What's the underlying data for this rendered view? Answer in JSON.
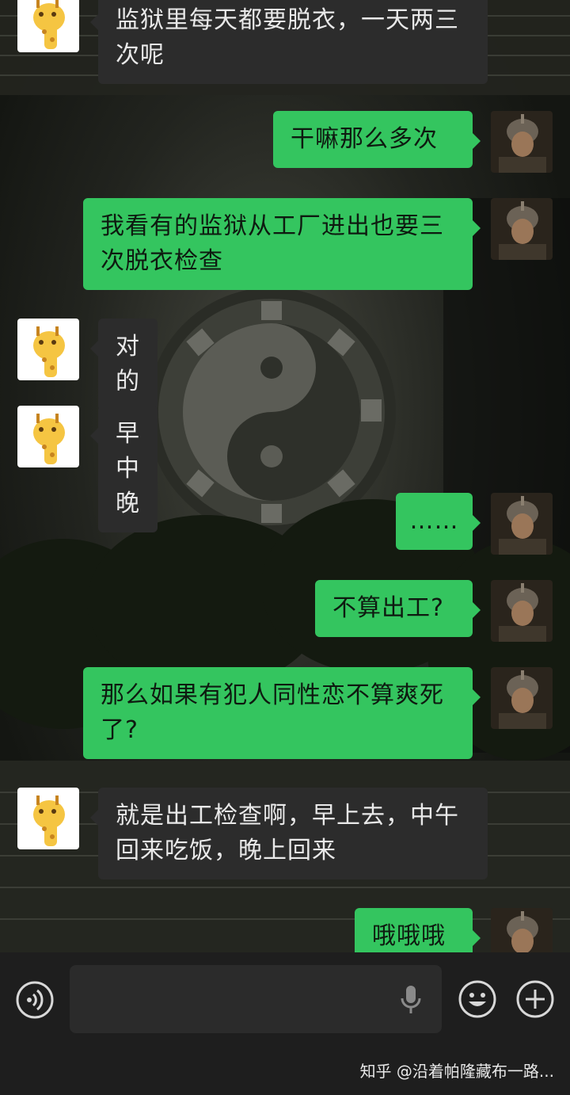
{
  "messages": [
    {
      "side": "in",
      "text": "监狱里每天都要脱衣，一天两三次呢"
    },
    {
      "side": "out",
      "text": "干嘛那么多次"
    },
    {
      "side": "out",
      "text": "我看有的监狱从工厂进出也要三次脱衣检查"
    },
    {
      "side": "in",
      "text": "对的"
    },
    {
      "side": "in",
      "text": "早中晚"
    },
    {
      "side": "out",
      "text": "……"
    },
    {
      "side": "out",
      "text": "不算出工?"
    },
    {
      "side": "out",
      "text": "那么如果有犯人同性恋不算爽死了?"
    },
    {
      "side": "in",
      "text": "就是出工检查啊，早上去，中午回来吃饭，晚上回来"
    },
    {
      "side": "out",
      "text": "哦哦哦"
    }
  ],
  "input_bar": {
    "voice_icon": "voice-toggle-icon",
    "mic_icon": "microphone-icon",
    "emoji_icon": "emoji-icon",
    "plus_icon": "plus-icon"
  },
  "footer": {
    "watermark": "知乎 @沿着帕隆藏布一路..."
  },
  "colors": {
    "outgoing_bubble": "#34c55f",
    "incoming_bubble": "#2c2c2c",
    "bar_background": "#1e1e1e"
  }
}
